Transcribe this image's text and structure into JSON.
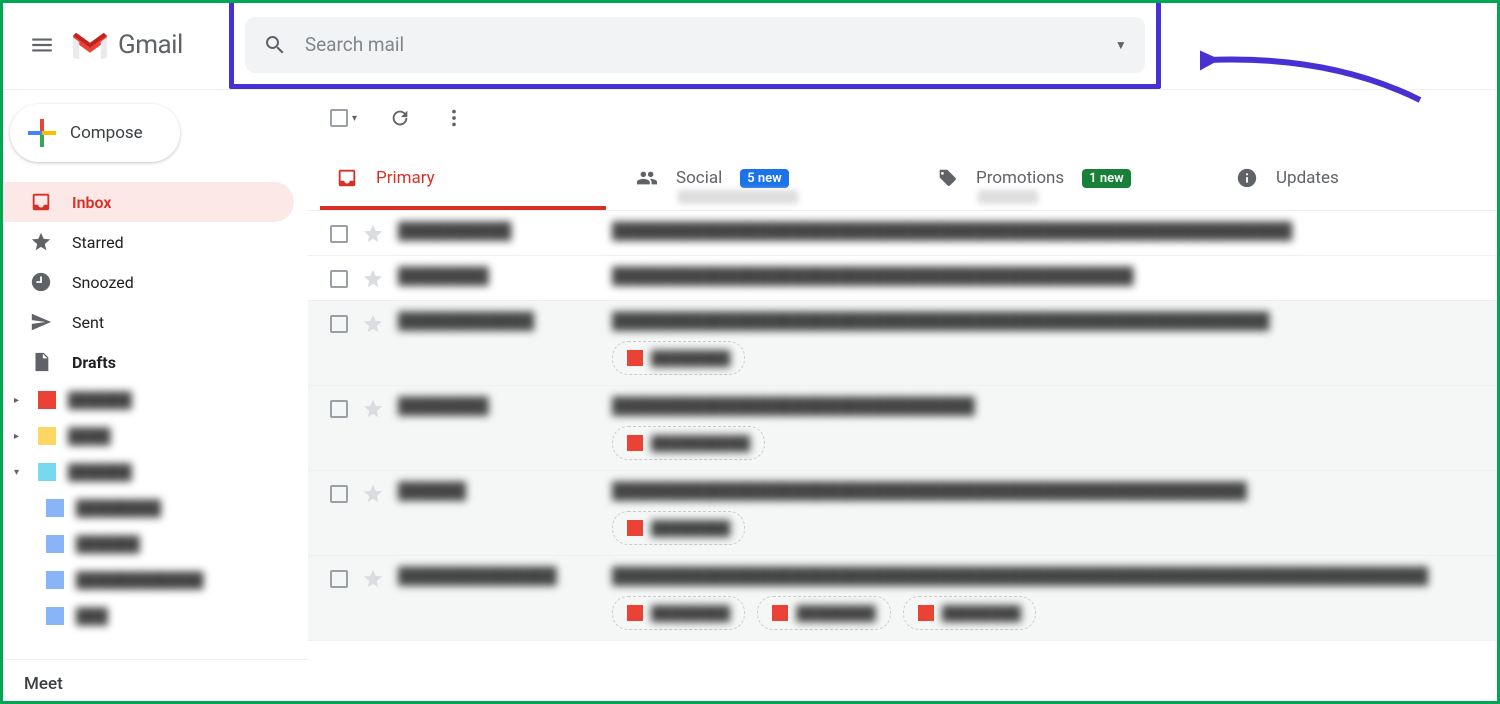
{
  "header": {
    "product_name": "Gmail",
    "search_placeholder": "Search mail"
  },
  "compose_label": "Compose",
  "nav": {
    "inbox": "Inbox",
    "starred": "Starred",
    "snoozed": "Snoozed",
    "sent": "Sent",
    "drafts": "Drafts"
  },
  "labels": [
    {
      "color": "#ea4335",
      "text": "██████"
    },
    {
      "color": "#fdd663",
      "text": "████"
    },
    {
      "color": "#78d9ec",
      "text": "██████"
    }
  ],
  "sublabels": [
    {
      "color": "#8ab4f8",
      "text": "████████"
    },
    {
      "color": "#8ab4f8",
      "text": "██████"
    },
    {
      "color": "#8ab4f8",
      "text": "████████████"
    },
    {
      "color": "#8ab4f8",
      "text": "███"
    }
  ],
  "meet_label": "Meet",
  "tabs": {
    "primary": "Primary",
    "social": "Social",
    "social_badge": "5 new",
    "promotions": "Promotions",
    "promotions_badge": "1 new",
    "updates": "Updates"
  },
  "emails": [
    {
      "read": false,
      "sender": "██████████",
      "subject": "████████████████████████████████████████████████████████████",
      "attachments": []
    },
    {
      "read": false,
      "sender": "████████",
      "subject": "██████████████████████████████████████████████",
      "attachments": []
    },
    {
      "read": true,
      "sender": "████████████",
      "subject": "██████████████████████████████████████████████████████████",
      "attachments": [
        "████████"
      ]
    },
    {
      "read": true,
      "sender": "████████",
      "subject": "████████████████████████████████",
      "attachments": [
        "██████████"
      ]
    },
    {
      "read": true,
      "sender": "██████",
      "subject": "████████████████████████████████████████████████████████",
      "attachments": [
        "████████"
      ]
    },
    {
      "read": true,
      "sender": "██████████████",
      "subject": "████████████████████████████████████████████████████████████████████████",
      "attachments": [
        "████████",
        "████████",
        "████████"
      ]
    }
  ]
}
